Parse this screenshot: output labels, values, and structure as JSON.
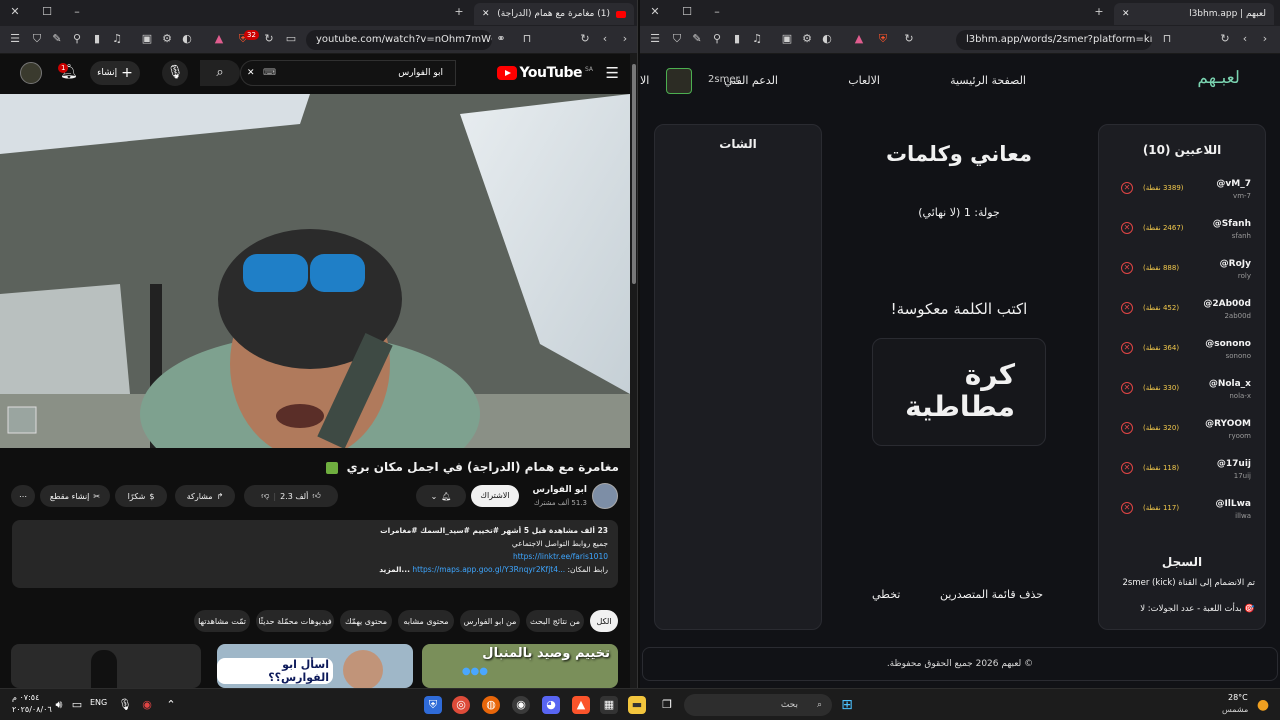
{
  "left_browser": {
    "tab_title": "(1) مغامرة مع همام (الدراجة) ف...",
    "url": "youtube.com/watch?v=nOhm7mWQUJI",
    "badge_count": "32"
  },
  "youtube": {
    "logo_text": "YouTube",
    "region": "SA",
    "search_value": "ابو الفوارس",
    "create_label": "إنشاء",
    "notification_count": "1",
    "video_title": "مغامرة مع همام (الدراجة) في اجمل مكان بري",
    "channel_name": "ابو الفوارس",
    "subscribers": "51.3 ألف مشترك",
    "subscribe_label": "الاشتراك",
    "likes": "2.3 ألف",
    "share_label": "مشاركة",
    "thanks_label": "شكرًا",
    "clip_label": "إنشاء مقطع",
    "description": {
      "stats": "23 ألف مشاهدة  قبل 5 أشهر  #تخييم #سيد_السمك #مغامرات",
      "line2": "جميع روابط التواصل الاجتماعي",
      "link1": "https://linktr.ee/faris1010",
      "line4_label": "رابط المكان:",
      "link2": "https://maps.app.goo.gl/Y3Rnqyr2Kfjt4...",
      "more": "...المزيد"
    },
    "chips": [
      "الكل",
      "من نتائج البحث",
      "من ابو الفوارس",
      "محتوى مشابه",
      "محتوى يهمّك",
      "فيديوهات محمّلة حديثًا",
      "تمّت مشاهدتها"
    ],
    "thumbnails": [
      "تخييم وصيد بالمنبال",
      "اسأل ابو الفوارس؟؟",
      ""
    ]
  },
  "right_browser": {
    "tab_title": "l3bhm.app | لعبهم",
    "url": "l3bhm.app/words/2smer?platform=kick"
  },
  "app": {
    "logo": "لعبـهم",
    "nav": [
      "الصفحة الرئيسية",
      "الالعاب",
      "الدعم الفني",
      "الا"
    ],
    "streamer": "2smer",
    "players_title": "اللاعبين (10)",
    "players": [
      {
        "name": "@vM_7",
        "user": "vm-7",
        "points": "(3389 نقطة)"
      },
      {
        "name": "@Sfanh",
        "user": "sfanh",
        "points": "(2467 نقطة)"
      },
      {
        "name": "@RoJy",
        "user": "roly",
        "points": "(888 نقطة)"
      },
      {
        "name": "@2Ab00d",
        "user": "2ab00d",
        "points": "(452 نقطة)"
      },
      {
        "name": "@sonono",
        "user": "sonono",
        "points": "(364 نقطة)"
      },
      {
        "name": "@Nola_x",
        "user": "nola-x",
        "points": "(330 نقطة)"
      },
      {
        "name": "@RYOOM",
        "user": "ryoom",
        "points": "(320 نقطة)"
      },
      {
        "name": "@17uij",
        "user": "17uij",
        "points": "(118 نقطة)"
      },
      {
        "name": "@IlLwa",
        "user": "illwa",
        "points": "(117 نقطة)"
      }
    ],
    "log_title": "السجل",
    "log_lines": [
      "تم الانضمام إلى القناة 2smer (kick)",
      "🎯 بدأت اللعبة - عدد الجولات: لا"
    ],
    "game_title": "معاني وكلمات",
    "round": "جولة: 1 (لا نهائي)",
    "instruction": "اكتب الكلمة معكوسة!",
    "word": "كرة مطاطية",
    "clear_label": "حذف قائمة المتصدرين",
    "skip_label": "تخطي",
    "chat_title": "الشات",
    "footer": "© لعبهم 2026 جميع الحقوق محفوظة."
  },
  "taskbar": {
    "search_placeholder": "بحث",
    "language": "ENG",
    "time": "٠٧:٥٤ م",
    "date": "٢٠٢٥/٠٨/٠٦",
    "temperature": "28°C",
    "weather": "مشمس"
  },
  "colors": {
    "youtube_red": "#ff0000",
    "link_blue": "#3ea6ff",
    "points_gold": "#f2c94c",
    "remove_red": "#e04444"
  }
}
